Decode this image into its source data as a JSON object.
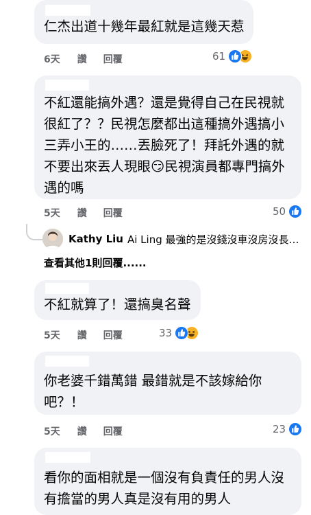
{
  "comments": [
    {
      "text": "仁杰出道十幾年最紅就是這幾天惹",
      "time": "6天",
      "like": "讚",
      "reply": "回覆",
      "reactions": "61"
    },
    {
      "text": "不紅還能搞外遇？還是覺得自己在民視就\n很紅了？？民視怎麼都出這種搞外遇搞小\n三弄小王的……丟臉死了！拜託外遇的就\n不要出來丟人現眼😏民視演員都專門搞外\n遇的嗎",
      "time": "5天",
      "like": "讚",
      "reply": "回覆",
      "reactions": "50"
    },
    {
      "text": "不紅就算了！還搞臭名聲",
      "time": "5天",
      "like": "讚",
      "reply": "回覆",
      "reactions": "33"
    },
    {
      "text": "你老婆千錯萬錯 最錯就是不該嫁給你\n吧？！",
      "time": "5天",
      "like": "讚",
      "reply": "回覆",
      "reactions": "23"
    },
    {
      "text": "看你的面相就是一個沒有負責任的男人沒\n有擔當的男人真是沒有用的男人"
    }
  ],
  "reply_preview": {
    "author": "Kathy Liu",
    "text": "Ai Ling 最強的是沒錢沒車沒房沒長…"
  },
  "more_replies": "查看其他1則回覆......",
  "colors": {
    "bubble": "#f0f2f5",
    "like_blue": "#1877f2",
    "haha_yellow": "#f7b125",
    "meta_gray": "#65676b"
  }
}
